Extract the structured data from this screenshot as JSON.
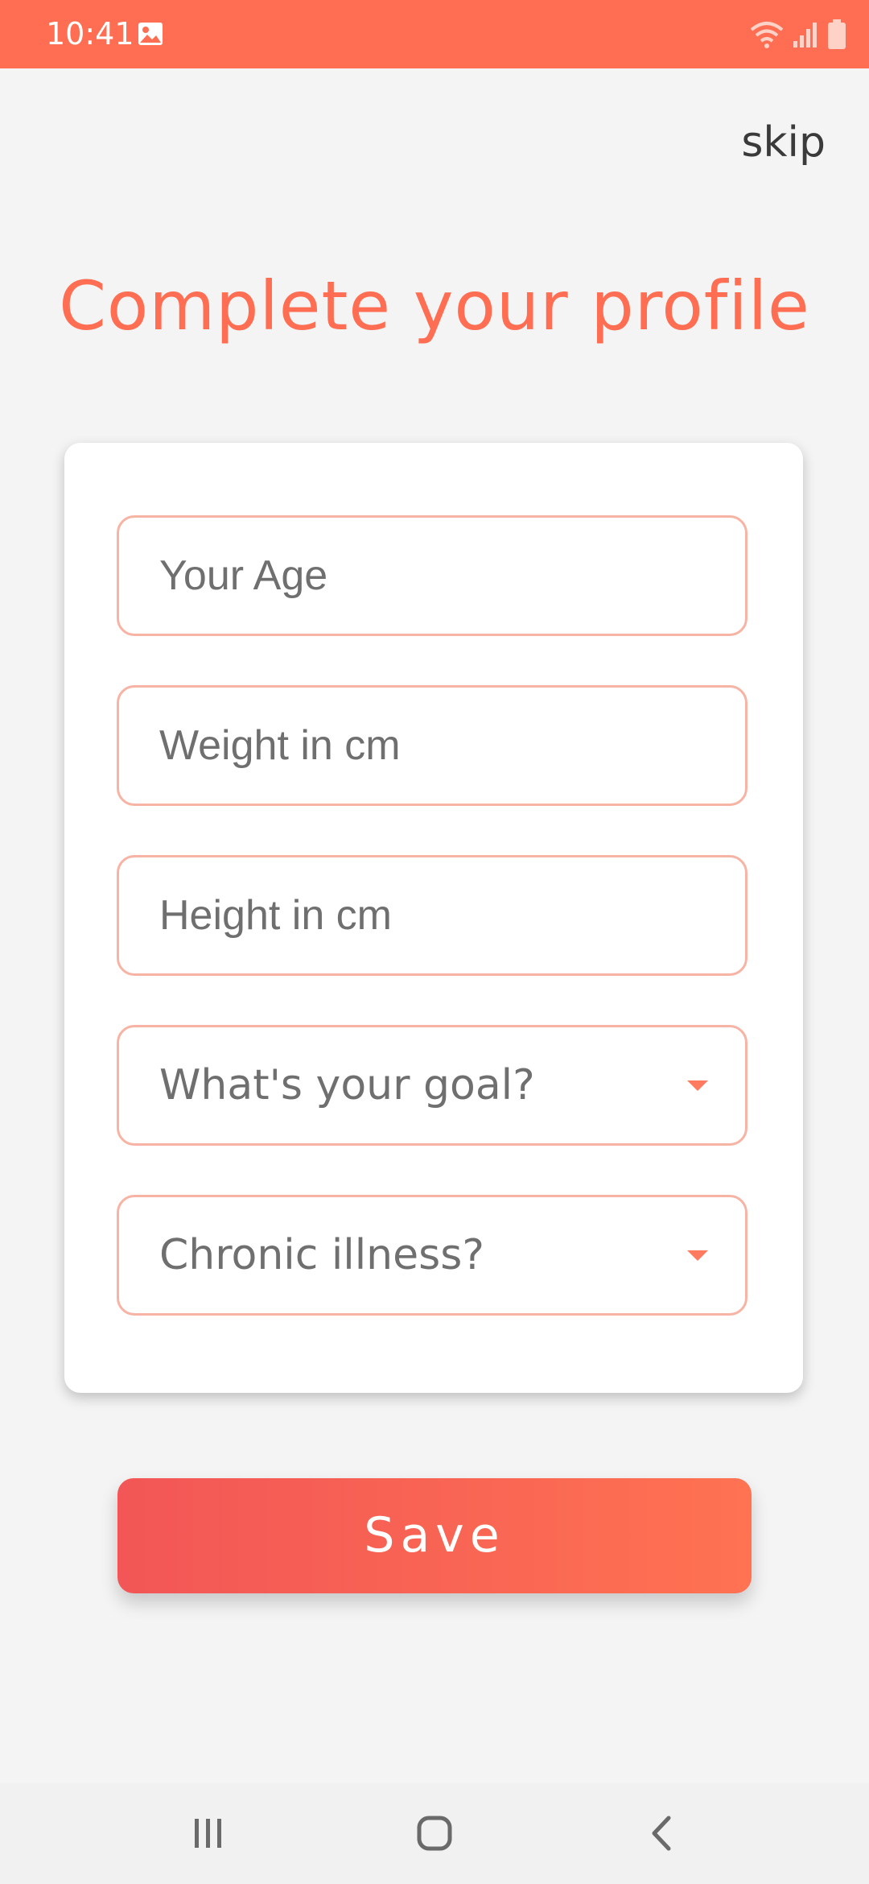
{
  "status_bar": {
    "time": "10:41",
    "background_color": "#ff6e52",
    "icons": [
      "gallery-icon",
      "wifi-icon",
      "signal-icon",
      "battery-icon"
    ]
  },
  "header": {
    "skip_label": "skip"
  },
  "title": "Complete your profile",
  "form": {
    "age_placeholder": "Your Age",
    "weight_placeholder": "Weight in cm",
    "height_placeholder": "Height in cm",
    "goal_selected": "What's your goal?",
    "illness_selected": "Chronic illness?"
  },
  "save_label": "Save",
  "nav": {
    "icons": [
      "recent-apps-icon",
      "home-icon",
      "back-icon"
    ]
  },
  "colors": {
    "accent": "#ff6e52",
    "field_border": "#f7b3a4",
    "button_gradient_start": "#f25656",
    "button_gradient_end": "#ff7252",
    "background": "#f4f4f4"
  }
}
